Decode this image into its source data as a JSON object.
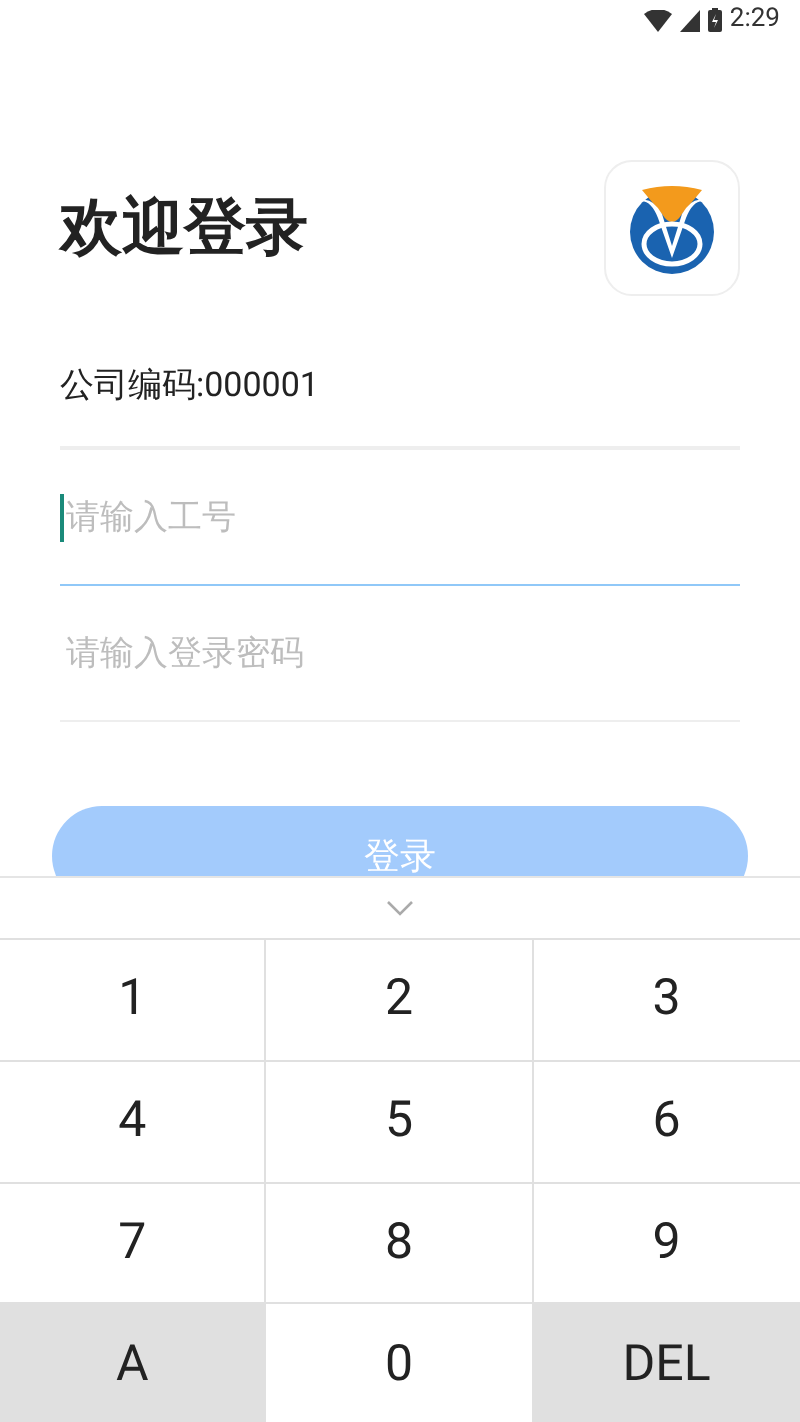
{
  "status_bar": {
    "time": "2:29"
  },
  "title": "欢迎登录",
  "company_code": "公司编码:000001",
  "fields": [
    {
      "placeholder": "请输入工号",
      "focused": true
    },
    {
      "placeholder": "请输入登录密码",
      "focused": false
    }
  ],
  "login_button": {
    "label": "登录",
    "disabled": true
  },
  "keypad": {
    "keys": [
      {
        "label": "1",
        "kind": "digit"
      },
      {
        "label": "2",
        "kind": "digit"
      },
      {
        "label": "3",
        "kind": "digit"
      },
      {
        "label": "4",
        "kind": "digit"
      },
      {
        "label": "5",
        "kind": "digit"
      },
      {
        "label": "6",
        "kind": "digit"
      },
      {
        "label": "7",
        "kind": "digit"
      },
      {
        "label": "8",
        "kind": "digit"
      },
      {
        "label": "9",
        "kind": "digit"
      },
      {
        "label": "A",
        "kind": "function"
      },
      {
        "label": "0",
        "kind": "digit"
      },
      {
        "label": "DEL",
        "kind": "function"
      }
    ]
  }
}
